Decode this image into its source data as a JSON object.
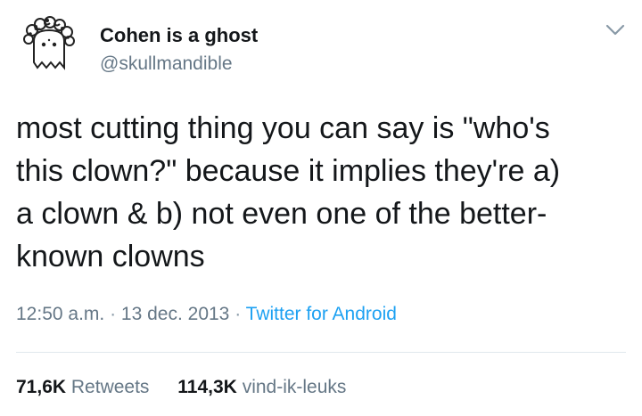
{
  "user": {
    "display_name": "Cohen is a ghost",
    "handle": "@skullmandible",
    "avatar_icon": "ghost-doodle-icon"
  },
  "tweet": {
    "lines": [
      "most cutting thing you can say is \"who's",
      "this clown?\" because it implies they're a)",
      "a clown & b) not even one of the better-",
      "known clowns"
    ]
  },
  "meta": {
    "time": "12:50 a.m.",
    "separator": "·",
    "date": "13 dec. 2013",
    "source": "Twitter for Android"
  },
  "stats": {
    "retweets_count": "71,6K",
    "retweets_label": "Retweets",
    "likes_count": "114,3K",
    "likes_label": "vind-ik-leuks"
  },
  "icons": {
    "menu": "chevron-down-icon"
  },
  "colors": {
    "text": "#14171a",
    "secondary": "#657786",
    "link": "#1da1f2",
    "divider": "#e1e8ed"
  }
}
